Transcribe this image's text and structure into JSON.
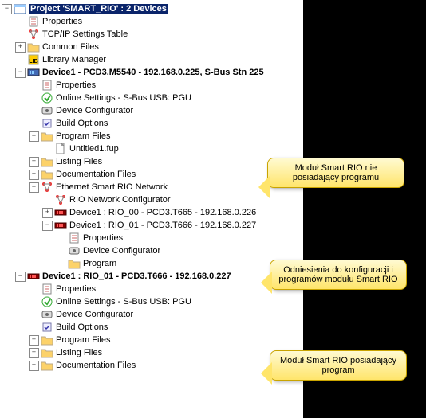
{
  "root": {
    "label": "Project 'SMART_RIO' : 2 Devices"
  },
  "properties": "Properties",
  "tcpip": "TCP/IP Settings Table",
  "common": "Common Files",
  "library": "Library Manager",
  "dev1": {
    "label": "Device1 - PCD3.M5540 - 192.168.0.225, S-Bus Stn 225",
    "properties": "Properties",
    "online": "Online Settings - S-Bus USB: PGU",
    "config": "Device Configurator",
    "build": "Build Options",
    "program": "Program Files",
    "untitled": "Untitled1.fup",
    "listing": "Listing Files",
    "docs": "Documentation Files",
    "ethernet": "Ethernet Smart RIO Network",
    "rionet": "RIO Network Configurator",
    "rio00": "Device1 : RIO_00 - PCD3.T665 - 192.168.0.226",
    "rio01": "Device1 : RIO_01 - PCD3.T666 - 192.168.0.227",
    "rio_prop": "Properties",
    "rio_conf": "Device Configurator",
    "rio_prog": "Program"
  },
  "dev2": {
    "label": "Device1 : RIO_01 - PCD3.T666 - 192.168.0.227",
    "properties": "Properties",
    "online": "Online Settings - S-Bus USB: PGU",
    "config": "Device Configurator",
    "build": "Build Options",
    "program": "Program Files",
    "listing": "Listing Files",
    "docs": "Documentation Files"
  },
  "callouts": {
    "c1": "Moduł Smart RIO nie posiadający programu",
    "c2": "Odniesienia do konfiguracji i programów modułu Smart RIO",
    "c3": "Moduł Smart RIO posiadający program"
  }
}
